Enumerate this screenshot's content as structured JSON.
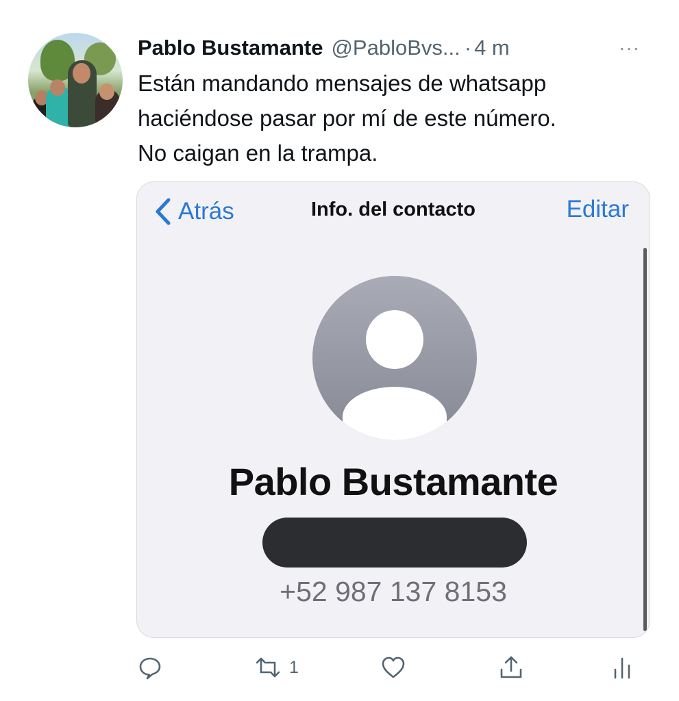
{
  "tweet": {
    "author_name": "Pablo Bustamante",
    "handle": "@PabloBvs...",
    "separator": "·",
    "time": "4 m",
    "more_label": "···",
    "text_lines": [
      "Están mandando mensajes de whatsapp",
      "haciéndose pasar por mí de este número.",
      "No caigan en la trampa."
    ]
  },
  "screenshot": {
    "back_label": "Atrás",
    "title": "Info. del contacto",
    "edit_label": "Editar",
    "contact_name": "Pablo Bustamante",
    "phone": "+52 987 137 8153"
  },
  "actions": {
    "reply_count": "",
    "retweet_count": "1",
    "like_count": "",
    "icons": [
      "reply-icon",
      "retweet-icon",
      "like-icon",
      "share-icon",
      "analytics-icon"
    ]
  },
  "colors": {
    "ios_blue": "#2a7ad2",
    "secondary_text": "#536471",
    "redaction": "#2b2d30"
  }
}
